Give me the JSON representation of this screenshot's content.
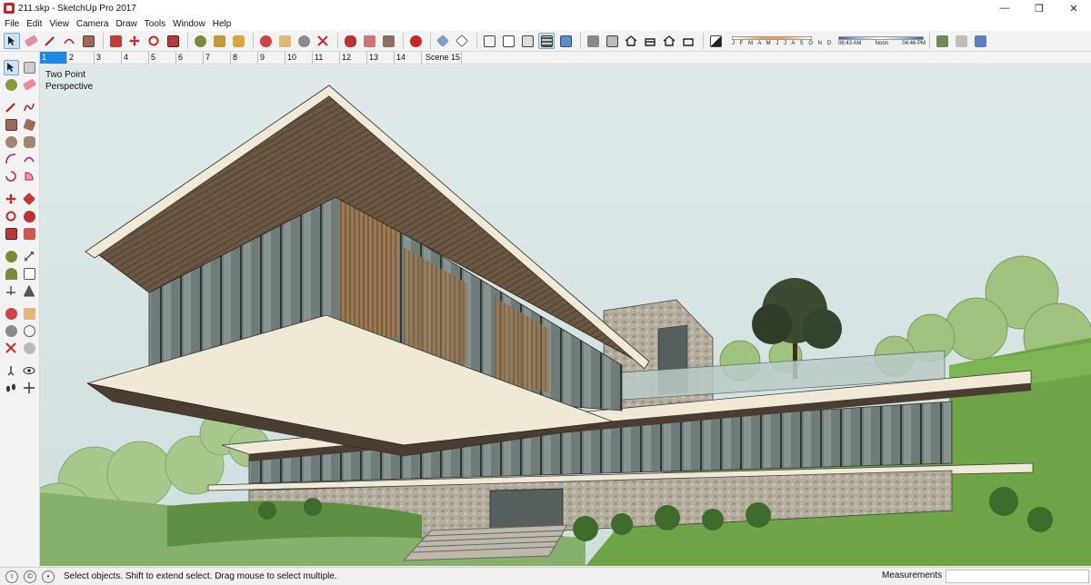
{
  "window": {
    "title": "211.skp - SketchUp Pro 2017",
    "minimize": "—",
    "maximize": "❐",
    "close": "✕"
  },
  "menu": [
    "File",
    "Edit",
    "View",
    "Camera",
    "Draw",
    "Tools",
    "Window",
    "Help"
  ],
  "shadows": {
    "months": "J F M A M J J A S O N D",
    "time_start": "06:43 AM",
    "time_mid": "Noon",
    "time_end": "04:46 PM"
  },
  "scenes": [
    "1",
    "2",
    "3",
    "4",
    "5",
    "6",
    "7",
    "8",
    "9",
    "10",
    "11",
    "12",
    "13",
    "14",
    "Scene 15"
  ],
  "active_scene": "1",
  "viewport": {
    "camera_label_line1": "Two Point",
    "camera_label_line2": "Perspective"
  },
  "status": {
    "message": "Select objects. Shift to extend select. Drag mouse to select multiple.",
    "measurements_label": "Measurements",
    "measurements_value": ""
  },
  "colors": {
    "accent": "#1e88e5",
    "sky": "#d7e4e4",
    "grass": "#5f9a3b",
    "wood": "#6e5a45",
    "slab": "#ece5cf",
    "glass": "#7f8e8e"
  }
}
